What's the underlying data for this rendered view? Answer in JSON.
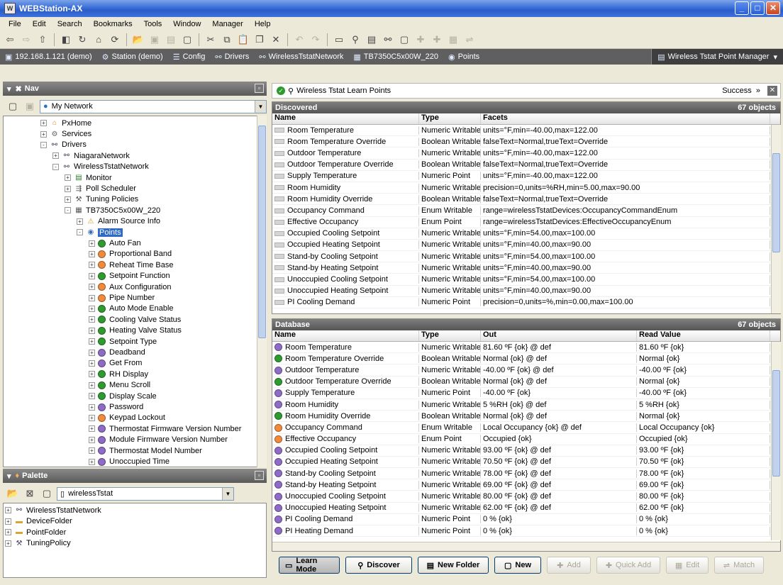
{
  "window": {
    "title": "WEBStation-AX"
  },
  "menu": [
    "File",
    "Edit",
    "Search",
    "Bookmarks",
    "Tools",
    "Window",
    "Manager",
    "Help"
  ],
  "locbar": {
    "items": [
      {
        "icon": "host-icon",
        "label": "192.168.1.121 (demo)"
      },
      {
        "icon": "station-icon",
        "label": "Station (demo)"
      },
      {
        "icon": "config-icon",
        "label": "Config"
      },
      {
        "icon": "drivers-icon",
        "label": "Drivers"
      },
      {
        "icon": "network-icon",
        "label": "WirelessTstatNetwork"
      },
      {
        "icon": "device-icon",
        "label": "TB7350C5x00W_220"
      },
      {
        "icon": "points-icon",
        "label": "Points"
      }
    ],
    "view": "Wireless Tstat Point Manager"
  },
  "nav": {
    "title": "Nav",
    "selector": "My Network",
    "tree": [
      {
        "label": "PxHome",
        "level": 3,
        "exp": "+",
        "icon": "home"
      },
      {
        "label": "Services",
        "level": 3,
        "exp": "+",
        "icon": "gear"
      },
      {
        "label": "Drivers",
        "level": 3,
        "exp": "-",
        "icon": "drv"
      },
      {
        "label": "NiagaraNetwork",
        "level": 4,
        "exp": "+",
        "icon": "net"
      },
      {
        "label": "WirelessTstatNetwork",
        "level": 4,
        "exp": "-",
        "icon": "net"
      },
      {
        "label": "Monitor",
        "level": 5,
        "exp": "+",
        "icon": "mon"
      },
      {
        "label": "Poll Scheduler",
        "level": 5,
        "exp": "+",
        "icon": "poll"
      },
      {
        "label": "Tuning Policies",
        "level": 5,
        "exp": "+",
        "icon": "tune"
      },
      {
        "label": "TB7350C5x00W_220",
        "level": 5,
        "exp": "-",
        "icon": "dev"
      },
      {
        "label": "Alarm Source Info",
        "level": 6,
        "exp": "+",
        "icon": "alarm"
      },
      {
        "label": "Points",
        "level": 6,
        "exp": "-",
        "icon": "pts",
        "selected": true
      },
      {
        "label": "Auto Fan",
        "level": 7,
        "exp": "+",
        "dot": "#2f9a2f"
      },
      {
        "label": "Proportional Band",
        "level": 7,
        "exp": "+",
        "dot": "#f08a3c"
      },
      {
        "label": "Reheat Time Base",
        "level": 7,
        "exp": "+",
        "dot": "#f08a3c"
      },
      {
        "label": "Setpoint Function",
        "level": 7,
        "exp": "+",
        "dot": "#2f9a2f"
      },
      {
        "label": "Aux Configuration",
        "level": 7,
        "exp": "+",
        "dot": "#f08a3c"
      },
      {
        "label": "Pipe Number",
        "level": 7,
        "exp": "+",
        "dot": "#f08a3c"
      },
      {
        "label": "Auto Mode Enable",
        "level": 7,
        "exp": "+",
        "dot": "#2f9a2f"
      },
      {
        "label": "Cooling Valve Status",
        "level": 7,
        "exp": "+",
        "dot": "#2f9a2f"
      },
      {
        "label": "Heating Valve Status",
        "level": 7,
        "exp": "+",
        "dot": "#2f9a2f"
      },
      {
        "label": "Setpoint Type",
        "level": 7,
        "exp": "+",
        "dot": "#2f9a2f"
      },
      {
        "label": "Deadband",
        "level": 7,
        "exp": "+",
        "dot": "#8e6bc5"
      },
      {
        "label": "Get From",
        "level": 7,
        "exp": "+",
        "dot": "#8e6bc5"
      },
      {
        "label": "RH Display",
        "level": 7,
        "exp": "+",
        "dot": "#2f9a2f"
      },
      {
        "label": "Menu Scroll",
        "level": 7,
        "exp": "+",
        "dot": "#2f9a2f"
      },
      {
        "label": "Display Scale",
        "level": 7,
        "exp": "+",
        "dot": "#2f9a2f"
      },
      {
        "label": "Password",
        "level": 7,
        "exp": "+",
        "dot": "#8e6bc5"
      },
      {
        "label": "Keypad Lockout",
        "level": 7,
        "exp": "+",
        "dot": "#f08a3c"
      },
      {
        "label": "Thermostat Firmware Version Number",
        "level": 7,
        "exp": "+",
        "dot": "#8e6bc5"
      },
      {
        "label": "Module Firmware Version Number",
        "level": 7,
        "exp": "+",
        "dot": "#8e6bc5"
      },
      {
        "label": "Thermostat Model Number",
        "level": 7,
        "exp": "+",
        "dot": "#8e6bc5"
      },
      {
        "label": "Unoccupied Time",
        "level": 7,
        "exp": "+",
        "dot": "#8e6bc5"
      }
    ]
  },
  "palette": {
    "title": "Palette",
    "selector": "wirelessTstat",
    "items": [
      "WirelessTstatNetwork",
      "DeviceFolder",
      "PointFolder",
      "TuningPolicy"
    ]
  },
  "learn": {
    "title": "Wireless Tstat Learn Points",
    "status": "Success"
  },
  "discovered": {
    "title": "Discovered",
    "count": "67 objects",
    "columns": [
      "Name",
      "Type",
      "Facets"
    ],
    "rows": [
      [
        "Room Temperature",
        "Numeric Writable",
        "units=°F,min=-40.00,max=122.00"
      ],
      [
        "Room Temperature Override",
        "Boolean Writable",
        "falseText=Normal,trueText=Override"
      ],
      [
        "Outdoor Temperature",
        "Numeric Writable",
        "units=°F,min=-40.00,max=122.00"
      ],
      [
        "Outdoor Temperature Override",
        "Boolean Writable",
        "falseText=Normal,trueText=Override"
      ],
      [
        "Supply Temperature",
        "Numeric Point",
        "units=°F,min=-40.00,max=122.00"
      ],
      [
        "Room Humidity",
        "Numeric Writable",
        "precision=0,units=%RH,min=5.00,max=90.00"
      ],
      [
        "Room Humidity Override",
        "Boolean Writable",
        "falseText=Normal,trueText=Override"
      ],
      [
        "Occupancy Command",
        "Enum Writable",
        "range=wirelessTstatDevices:OccupancyCommandEnum"
      ],
      [
        "Effective Occupancy",
        "Enum Point",
        "range=wirelessTstatDevices:EffectiveOccupancyEnum"
      ],
      [
        "Occupied Cooling Setpoint",
        "Numeric Writable",
        "units=°F,min=54.00,max=100.00"
      ],
      [
        "Occupied Heating Setpoint",
        "Numeric Writable",
        "units=°F,min=40.00,max=90.00"
      ],
      [
        "Stand-by Cooling Setpoint",
        "Numeric Writable",
        "units=°F,min=54.00,max=100.00"
      ],
      [
        "Stand-by Heating Setpoint",
        "Numeric Writable",
        "units=°F,min=40.00,max=90.00"
      ],
      [
        "Unoccupied Cooling Setpoint",
        "Numeric Writable",
        "units=°F,min=54.00,max=100.00"
      ],
      [
        "Unoccupied Heating Setpoint",
        "Numeric Writable",
        "units=°F,min=40.00,max=90.00"
      ],
      [
        "PI Cooling Demand",
        "Numeric Point",
        "precision=0,units=%,min=0.00,max=100.00"
      ]
    ]
  },
  "database": {
    "title": "Database",
    "count": "67 objects",
    "columns": [
      "Name",
      "Type",
      "Out",
      "Read Value"
    ],
    "rows": [
      [
        "Room Temperature",
        "Numeric Writable",
        "81.60 ºF {ok} @ def",
        "81.60 ºF {ok}",
        "#8e6bc5"
      ],
      [
        "Room Temperature Override",
        "Boolean Writable",
        "Normal {ok} @ def",
        "Normal {ok}",
        "#2f9a2f"
      ],
      [
        "Outdoor Temperature",
        "Numeric Writable",
        "-40.00 ºF {ok} @ def",
        "-40.00 ºF {ok}",
        "#8e6bc5"
      ],
      [
        "Outdoor Temperature Override",
        "Boolean Writable",
        "Normal {ok} @ def",
        "Normal {ok}",
        "#2f9a2f"
      ],
      [
        "Supply Temperature",
        "Numeric Point",
        "-40.00 ºF {ok}",
        "-40.00 ºF {ok}",
        "#8e6bc5"
      ],
      [
        "Room Humidity",
        "Numeric Writable",
        "5 %RH {ok} @ def",
        "5 %RH {ok}",
        "#8e6bc5"
      ],
      [
        "Room Humidity Override",
        "Boolean Writable",
        "Normal {ok} @ def",
        "Normal {ok}",
        "#2f9a2f"
      ],
      [
        "Occupancy Command",
        "Enum Writable",
        "Local Occupancy {ok} @ def",
        "Local Occupancy {ok}",
        "#f08a3c"
      ],
      [
        "Effective Occupancy",
        "Enum Point",
        "Occupied {ok}",
        "Occupied {ok}",
        "#f08a3c"
      ],
      [
        "Occupied Cooling Setpoint",
        "Numeric Writable",
        "93.00 ºF {ok} @ def",
        "93.00 ºF {ok}",
        "#8e6bc5"
      ],
      [
        "Occupied Heating Setpoint",
        "Numeric Writable",
        "70.50 ºF {ok} @ def",
        "70.50 ºF {ok}",
        "#8e6bc5"
      ],
      [
        "Stand-by Cooling Setpoint",
        "Numeric Writable",
        "78.00 ºF {ok} @ def",
        "78.00 ºF {ok}",
        "#8e6bc5"
      ],
      [
        "Stand-by Heating Setpoint",
        "Numeric Writable",
        "69.00 ºF {ok} @ def",
        "69.00 ºF {ok}",
        "#8e6bc5"
      ],
      [
        "Unoccupied Cooling Setpoint",
        "Numeric Writable",
        "80.00 ºF {ok} @ def",
        "80.00 ºF {ok}",
        "#8e6bc5"
      ],
      [
        "Unoccupied Heating Setpoint",
        "Numeric Writable",
        "62.00 ºF {ok} @ def",
        "62.00 ºF {ok}",
        "#8e6bc5"
      ],
      [
        "PI Cooling Demand",
        "Numeric Point",
        "0 % {ok}",
        "0 % {ok}",
        "#8e6bc5"
      ],
      [
        "PI Heating Demand",
        "Numeric Point",
        "0 % {ok}",
        "0 % {ok}",
        "#8e6bc5"
      ]
    ]
  },
  "buttons": [
    {
      "label": "Learn Mode",
      "icon": "▭",
      "enabled": true,
      "dark": true
    },
    {
      "label": "Discover",
      "icon": "⚲",
      "enabled": true
    },
    {
      "label": "New Folder",
      "icon": "▤",
      "enabled": true
    },
    {
      "label": "New",
      "icon": "▢",
      "enabled": true
    },
    {
      "label": "Add",
      "icon": "✚",
      "enabled": false
    },
    {
      "label": "Quick Add",
      "icon": "✚",
      "enabled": false
    },
    {
      "label": "Edit",
      "icon": "▦",
      "enabled": false
    },
    {
      "label": "Match",
      "icon": "⇌",
      "enabled": false
    }
  ]
}
